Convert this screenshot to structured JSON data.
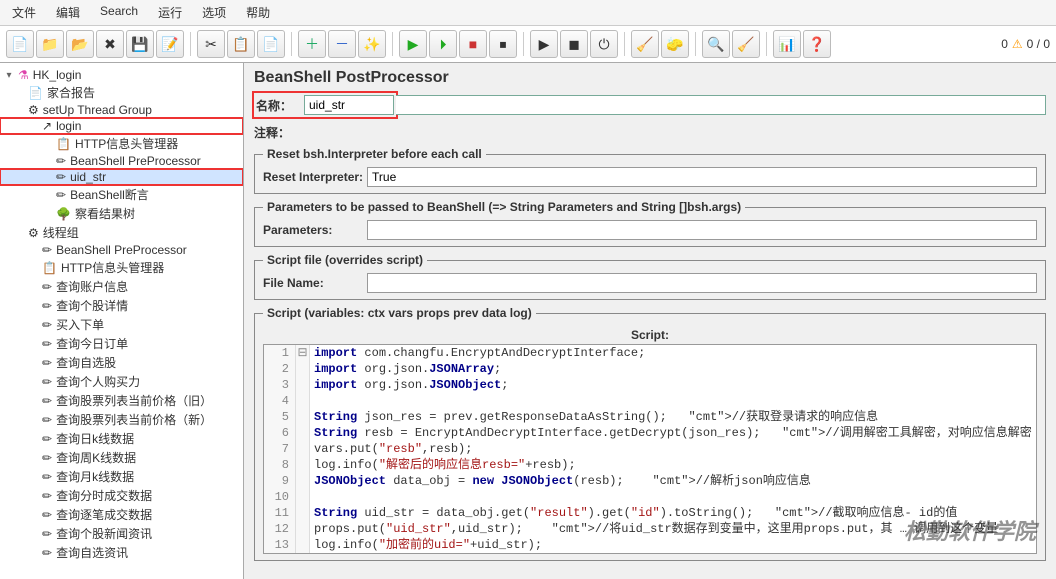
{
  "menu": [
    "文件",
    "编辑",
    "Search",
    "运行",
    "选项",
    "帮助"
  ],
  "status": {
    "warn": "0",
    "err": "0 / 0"
  },
  "tree": {
    "root": "HK_login",
    "items": [
      {
        "label": "家合报告",
        "icon": "📄",
        "ind": 1
      },
      {
        "label": "setUp Thread Group",
        "icon": "⚙",
        "ind": 1
      },
      {
        "label": "login",
        "icon": "↗",
        "ind": 2,
        "red": true
      },
      {
        "label": "HTTP信息头管理器",
        "icon": "📋",
        "ind": 3
      },
      {
        "label": "BeanShell PreProcessor",
        "icon": "✏",
        "ind": 3
      },
      {
        "label": "uid_str",
        "icon": "✏",
        "ind": 3,
        "red": true,
        "sel": true
      },
      {
        "label": "BeanShell断言",
        "icon": "✏",
        "ind": 3
      },
      {
        "label": "察看结果树",
        "icon": "🌳",
        "ind": 3
      },
      {
        "label": "线程组",
        "icon": "⚙",
        "ind": 1
      },
      {
        "label": "BeanShell PreProcessor",
        "icon": "✏",
        "ind": 2
      },
      {
        "label": "HTTP信息头管理器",
        "icon": "📋",
        "ind": 2
      },
      {
        "label": "查询账户信息",
        "icon": "✏",
        "ind": 2
      },
      {
        "label": "查询个股详情",
        "icon": "✏",
        "ind": 2
      },
      {
        "label": "买入下单",
        "icon": "✏",
        "ind": 2
      },
      {
        "label": "查询今日订单",
        "icon": "✏",
        "ind": 2
      },
      {
        "label": "查询自选股",
        "icon": "✏",
        "ind": 2
      },
      {
        "label": "查询个人购买力",
        "icon": "✏",
        "ind": 2
      },
      {
        "label": "查询股票列表当前价格（旧）",
        "icon": "✏",
        "ind": 2
      },
      {
        "label": "查询股票列表当前价格（新）",
        "icon": "✏",
        "ind": 2
      },
      {
        "label": "查询日k线数据",
        "icon": "✏",
        "ind": 2
      },
      {
        "label": "查询周K线数据",
        "icon": "✏",
        "ind": 2
      },
      {
        "label": "查询月k线数据",
        "icon": "✏",
        "ind": 2
      },
      {
        "label": "查询分时成交数据",
        "icon": "✏",
        "ind": 2
      },
      {
        "label": "查询逐笔成交数据",
        "icon": "✏",
        "ind": 2
      },
      {
        "label": "查询个股新闻资讯",
        "icon": "✏",
        "ind": 2
      },
      {
        "label": "查询自选资讯",
        "icon": "✏",
        "ind": 2
      }
    ]
  },
  "panel": {
    "title": "BeanShell PostProcessor",
    "name_label": "名称：",
    "name_value": "uid_str",
    "comment_label": "注释：",
    "fs_reset": "Reset bsh.Interpreter before each call",
    "reset_label": "Reset Interpreter:",
    "reset_value": "True",
    "fs_params": "Parameters to be passed to BeanShell (=> String Parameters and String []bsh.args)",
    "params_label": "Parameters:",
    "params_value": "",
    "fs_file": "Script file (overrides script)",
    "file_label": "File Name:",
    "file_value": "",
    "fs_script": "Script (variables: ctx vars props prev data log)",
    "script_label": "Script:"
  },
  "script_lines": [
    {
      "n": 1,
      "fold": "⊟",
      "code": "import com.changfu.EncryptAndDecryptInterface;"
    },
    {
      "n": 2,
      "code": "import org.json.JSONArray;"
    },
    {
      "n": 3,
      "code": "import org.json.JSONObject;"
    },
    {
      "n": 4,
      "code": ""
    },
    {
      "n": 5,
      "code": "String json_res = prev.getResponseDataAsString();   //获取登录请求的响应信息"
    },
    {
      "n": 6,
      "code": "String resb = EncryptAndDecryptInterface.getDecrypt(json_res);   //调用解密工具解密，对响应信息解密"
    },
    {
      "n": 7,
      "code": "vars.put(\"resb\",resb);"
    },
    {
      "n": 8,
      "code": "log.info(\"解密后的响应信息resb=\"+resb);"
    },
    {
      "n": 9,
      "code": "JSONObject data_obj = new JSONObject(resb);    //解析json响应信息"
    },
    {
      "n": 10,
      "code": ""
    },
    {
      "n": 11,
      "code": "String uid_str = data_obj.get(\"result\").get(\"id\").toString();   //截取响应信息- id的值"
    },
    {
      "n": 12,
      "code": "props.put(\"uid_str\",uid_str);    //将uid_str数据存到变量中，这里用props.put，其 … 调用到这个变量"
    },
    {
      "n": 13,
      "code": "log.info(\"加密前的uid=\"+uid_str);"
    }
  ],
  "watermark": "松勤软件学院"
}
